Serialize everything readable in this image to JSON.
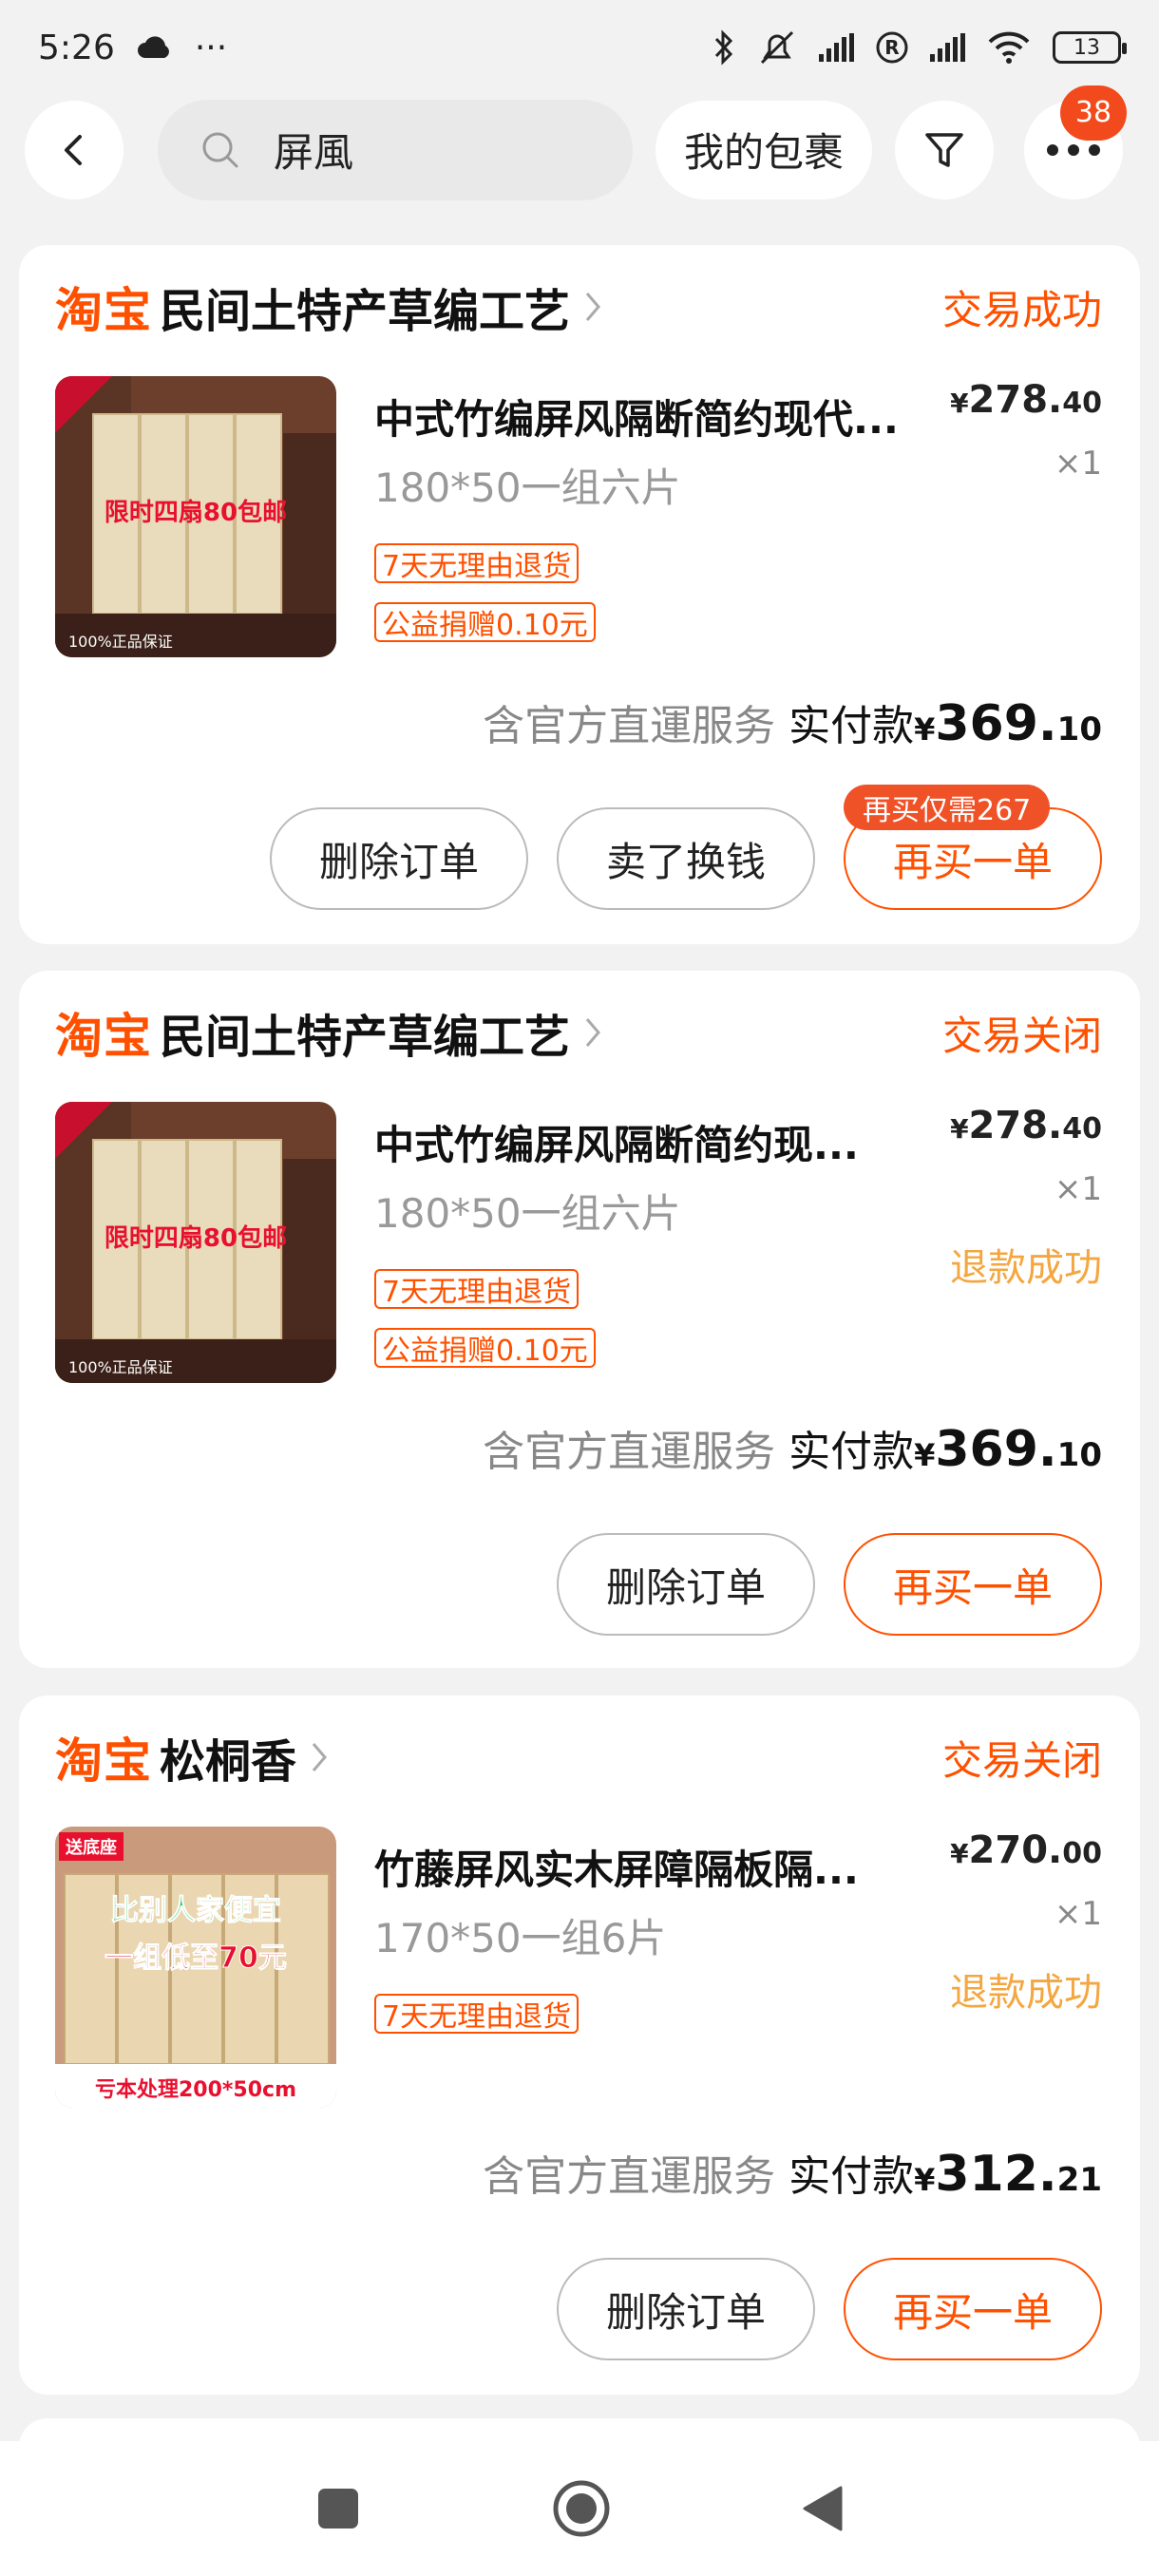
{
  "status_bar": {
    "time": "5:26",
    "overflow": "···",
    "battery": "13"
  },
  "top_bar": {
    "search_query": "屏風",
    "my_packages": "我的包裹",
    "more_badge": "38"
  },
  "orders": [
    {
      "platform": "淘宝",
      "shop": "民间土特产草编工艺",
      "status": "交易成功",
      "title": "中式竹编屏风隔断简约现代...",
      "spec": "180*50一组六片",
      "tags": [
        "7天无理由退货",
        "公益捐赠0.10元"
      ],
      "price_cur": "¥",
      "price_int": "278.",
      "price_dec": "40",
      "qty": "×1",
      "service": "含官方直運服务",
      "paid_label": "实付款",
      "paid_cur": "¥",
      "paid_int": "369.",
      "paid_dec": "10",
      "buttons": [
        "删除订单",
        "卖了换钱",
        "再买一单"
      ],
      "promo": "再买仅需267",
      "thumb_text": "限时四扇80包邮",
      "thumb_footer": "100%正品保证"
    },
    {
      "platform": "淘宝",
      "shop": "民间土特产草编工艺",
      "status": "交易关闭",
      "title": "中式竹编屏风隔断简约现...",
      "spec": "180*50一组六片",
      "tags": [
        "7天无理由退货",
        "公益捐赠0.10元"
      ],
      "price_cur": "¥",
      "price_int": "278.",
      "price_dec": "40",
      "qty": "×1",
      "refund": "退款成功",
      "service": "含官方直運服务",
      "paid_label": "实付款",
      "paid_cur": "¥",
      "paid_int": "369.",
      "paid_dec": "10",
      "buttons": [
        "删除订单",
        "再买一单"
      ],
      "thumb_text": "限时四扇80包邮",
      "thumb_footer": "100%正品保证"
    },
    {
      "platform": "淘宝",
      "shop": "松桐香",
      "status": "交易关闭",
      "title": "竹藤屏风实木屏障隔板隔...",
      "spec": "170*50一组6片",
      "tags": [
        "7天无理由退货"
      ],
      "price_cur": "¥",
      "price_int": "270.",
      "price_dec": "00",
      "qty": "×1",
      "refund": "退款成功",
      "service": "含官方直運服务",
      "paid_label": "实付款",
      "paid_cur": "¥",
      "paid_int": "312.",
      "paid_dec": "21",
      "buttons": [
        "删除订单",
        "再买一单"
      ],
      "thumb_badge": "送底座",
      "thumb_line1": "比别人家便宜",
      "thumb_line2": "一组低至70元",
      "thumb_footer": "亏本处理200*50cm"
    }
  ],
  "colors": {
    "accent": "#ff5000",
    "refund": "#f4a640",
    "badge": "#f24a1c",
    "background": "#f2f2f2"
  }
}
